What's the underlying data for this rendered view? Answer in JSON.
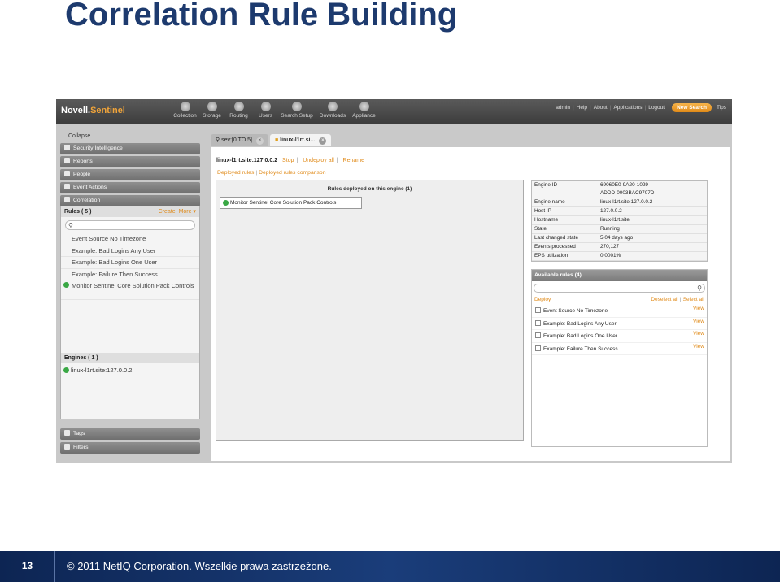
{
  "slide": {
    "title": "Correlation Rule Building",
    "page_number": "13",
    "footer": "© 2011 NetIQ Corporation.  Wszelkie prawa zastrzeżone."
  },
  "app": {
    "brand_novell": "Novell.",
    "brand_sentinel": "Sentinel",
    "nav": [
      {
        "label": "Collection",
        "icon": "collection-icon"
      },
      {
        "label": "Storage",
        "icon": "storage-icon"
      },
      {
        "label": "Routing",
        "icon": "routing-icon"
      },
      {
        "label": "Users",
        "icon": "users-icon"
      },
      {
        "label": "Search Setup",
        "icon": "search-setup-icon"
      },
      {
        "label": "Downloads",
        "icon": "downloads-icon"
      },
      {
        "label": "Appliance",
        "icon": "appliance-icon"
      }
    ],
    "top_links": {
      "admin": "admin",
      "help": "Help",
      "about": "About",
      "applications": "Applications",
      "logout": "Logout",
      "new_search": "New Search",
      "tips": "Tips"
    }
  },
  "sidebar": {
    "collapse": "Collapse",
    "sections": {
      "security_intelligence": "Security Intelligence",
      "reports": "Reports",
      "people": "People",
      "event_actions": "Event Actions",
      "correlation": "Correlation",
      "tags": "Tags",
      "filters": "Filters"
    },
    "rules_header": "Rules ( 5 )",
    "create": "Create",
    "more": "More ▾",
    "rules": [
      "Event Source No Timezone",
      "Example: Bad Logins Any User",
      "Example: Bad Logins One User",
      "Example: Failure Then Success"
    ],
    "active_rule": "Monitor Sentinel Core Solution Pack Controls",
    "engines_header": "Engines ( 1 )",
    "engine": "linux-l1rt.site:127.0.0.2"
  },
  "tabs": {
    "tab1": "sev:[0 TO 5]",
    "tab2": "linux-l1rt.si..."
  },
  "engine_panel": {
    "engine_name": "linux-l1rt.site:127.0.0.2",
    "stop": "Stop",
    "undeploy_all": "Undeploy all",
    "rename": "Rename",
    "deployed_rules": "Deployed rules",
    "deployed_rules_comparison": "Deployed rules comparison",
    "deployed_header": "Rules deployed on this engine (1)",
    "deployed_item": "Monitor Sentinel Core Solution Pack Controls"
  },
  "engine_info": [
    {
      "key": "Engine ID",
      "value": "69060E0-9A20-1029-\nADDD-0003BAC9707D"
    },
    {
      "key": "Engine name",
      "value": "linux-l1rt.site:127.0.0.2"
    },
    {
      "key": "Host IP",
      "value": "127.0.0.2"
    },
    {
      "key": "Hostname",
      "value": "linux-l1rt.site"
    },
    {
      "key": "State",
      "value": "Running"
    },
    {
      "key": "Last changed state",
      "value": "5.04 days ago"
    },
    {
      "key": "Events processed",
      "value": "270,127"
    },
    {
      "key": "EPS utilization",
      "value": "0.0001%"
    }
  ],
  "available": {
    "header": "Available rules (4)",
    "deploy": "Deploy",
    "deselect_all": "Deselect all",
    "select_all": "Select all",
    "view": "View",
    "items": [
      "Event Source No Timezone",
      "Example: Bad Logins Any User",
      "Example: Bad Logins One User",
      "Example: Failure Then Success"
    ]
  }
}
